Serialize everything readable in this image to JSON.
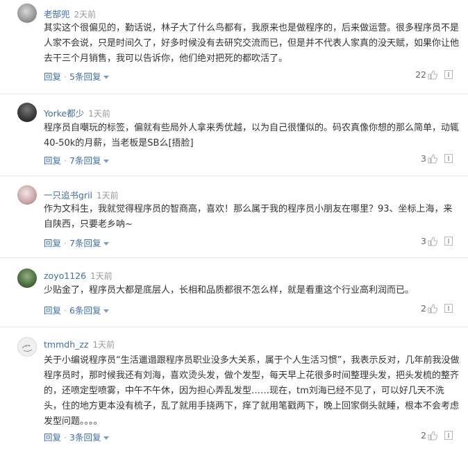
{
  "comments": [
    {
      "user": "老郜兜",
      "time": "2天前",
      "text": "其实这个很偏见的，勤话说，林子大了什么鸟都有，我原来也是做程序的，后来做运营。很多程序员不是人家不会说，只是时间久了，好多时候没有去研究交流而已，但是并不代表人家真的没天赋，如果你让他去干三个月销售，我可以告诉你，他们绝对把死的都吹活了。",
      "reply": "回复",
      "replies": "5条回复",
      "likes": "22"
    },
    {
      "user": "Yorke都少",
      "time": "1天前",
      "text": "程序员自嘲玩的标签，偏就有些局外人拿来秀优越，以为自己很懂似的。码农真像你想的那么简单，动辄40-50k的月薪，当老板是SB么[捂脸]",
      "reply": "回复",
      "replies": "7条回复",
      "likes": "3"
    },
    {
      "user": "一只追书gril",
      "time": "1天前",
      "text": "作为文科生，我就觉得程序员的智商高，喜欢！那么属于我的程序员小朋友在哪里？93、坐标上海，来自陕西，只要老乡呐~",
      "reply": "回复",
      "replies": "7条回复",
      "likes": "3"
    },
    {
      "user": "zoyo1126",
      "time": "1天前",
      "text": "少贴金了，程序员大都是底层人，长相和品质都很不怎么样，就是看重这个行业高利润而已。",
      "reply": "回复",
      "replies": "6条回复",
      "likes": "2"
    },
    {
      "user": "tmmdh_zz",
      "time": "1天前",
      "text": "关于小编说程序员“生活邋遢跟程序员职业没多大关系，属于个人生活习惯”，我表示反对，几年前我没做程序员时，那时候我还有刘海，喜欢烫头发，做个发型，每天早上花很多时间整理头发，把头发梳的整齐的，还喷定型喷雾，中午不午休，因为担心弄乱发型……现在，tm刘海已经不见了，可以好几天不洗头，住的地方更本没有梳子，乱了就用手挠两下，痒了就用笔戳两下，晚上回家倒头就睡，根本不会考虑发型问题。。。。",
      "reply": "回复",
      "replies": "3条回复",
      "likes": "2"
    }
  ],
  "icons": {
    "like": "thumbs-up-icon",
    "report": "report-icon",
    "expand": "caret-down-icon"
  },
  "colors": {
    "link": "#3f6ea8",
    "meta": "#999999",
    "text": "#333333",
    "divider": "#e9e9e9"
  }
}
